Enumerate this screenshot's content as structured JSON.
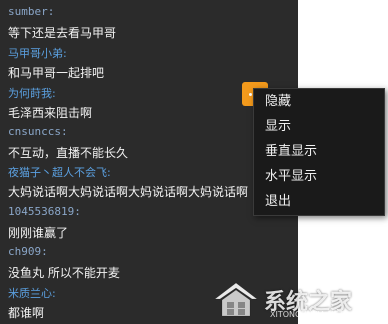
{
  "messages": [
    {
      "sender": "sumber:",
      "text": "等下还是去看马甲哥"
    },
    {
      "sender": "马甲哥小弟:",
      "text": "和马甲哥一起排吧"
    },
    {
      "sender": "为何莳我:",
      "text": "毛泽西来阻击啊"
    },
    {
      "sender": "cnsunccs:",
      "text": "不互动，直播不能长久"
    },
    {
      "sender": "夜猫子丶超人不会飞:",
      "text": "大妈说话啊大妈说话啊大妈说话啊大妈说话啊"
    },
    {
      "sender": "1045536819:",
      "text": "刚刚谁赢了"
    },
    {
      "sender": "ch909:",
      "text": "没鱼丸 所以不能开麦"
    },
    {
      "sender": "米质兰心:",
      "text": "都谁啊"
    }
  ],
  "context_menu": {
    "items": [
      "隐藏",
      "显示",
      "垂直显示",
      "水平显示",
      "退出"
    ]
  },
  "watermark": {
    "text": "系统之家",
    "url": "XITONGZHIJIA.NET"
  },
  "colors": {
    "panel_bg": "#2b2b2b",
    "sender": "#5ba0e0",
    "accent": "#f39a1c",
    "menu_bg": "#1a1a1a"
  }
}
